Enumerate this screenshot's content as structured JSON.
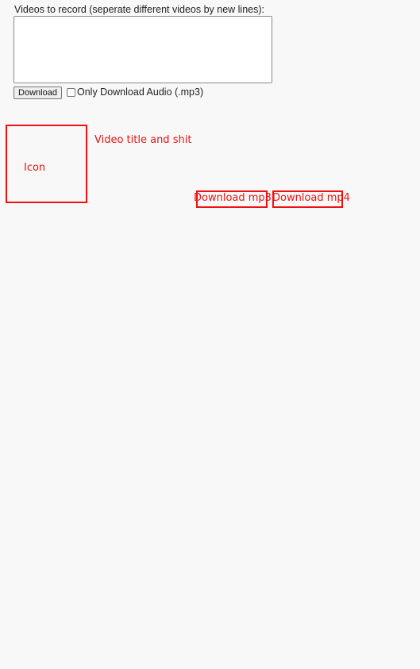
{
  "form": {
    "label": "Videos to record (seperate different videos by new lines):",
    "textarea_value": "",
    "download_button": "Download",
    "audio_only_label": "Only Download Audio (.mp3)",
    "audio_only_checked": false
  },
  "mockup": {
    "icon_label": "Icon",
    "title_label": "Video title and shit",
    "download_mp3": "Download mp3",
    "download_mp4": "Download mp4",
    "accent_color": "#ee1111"
  }
}
